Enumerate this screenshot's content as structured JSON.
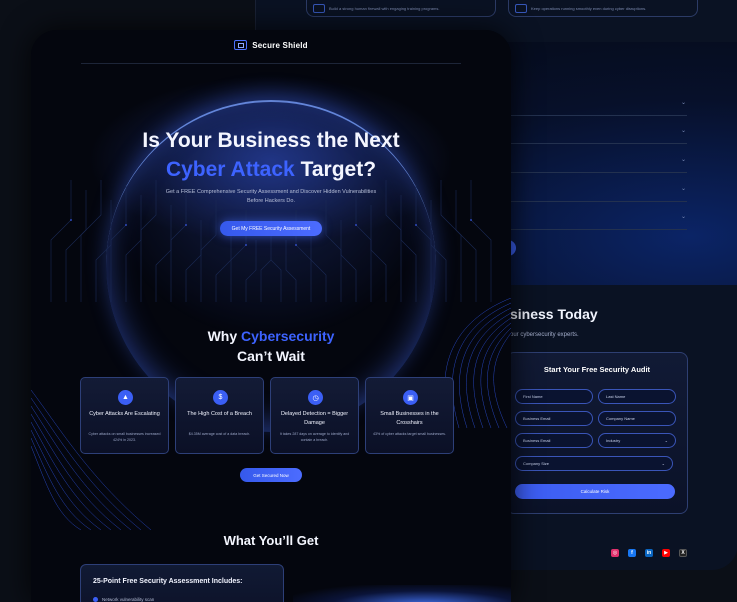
{
  "background_page": {
    "top_features": [
      {
        "text": "Build a strong human firewall with engaging training programs."
      },
      {
        "text": "Keep operations running smoothly even during cyber disruptions."
      }
    ],
    "faq_heading_fragment": "s",
    "faq_rows": 6,
    "consult": {
      "headline_fragment": "siness Today",
      "sub_fragment": "our cybersecurity experts."
    },
    "audit_form": {
      "title": "Start Your Free Security Audit",
      "first_name": "First Name",
      "last_name": "Last Name",
      "business_email": "Business Email",
      "company_name": "Company Name",
      "business_email_2": "Business Email",
      "industry": "Industry",
      "company_size": "Company Size",
      "submit": "Calculate Risk"
    },
    "socials": [
      {
        "name": "instagram-icon",
        "glyph": "◎",
        "color": "#e1306c"
      },
      {
        "name": "facebook-icon",
        "glyph": "f",
        "color": "#1877f2"
      },
      {
        "name": "linkedin-icon",
        "glyph": "in",
        "color": "#0a66c2"
      },
      {
        "name": "youtube-icon",
        "glyph": "▶",
        "color": "#ff0000"
      },
      {
        "name": "x-icon",
        "glyph": "X",
        "color": "#222222"
      }
    ]
  },
  "front_page": {
    "brand": "Secure Shield",
    "hero": {
      "title_line1": "Is Your Business the Next",
      "title_accent": "Cyber Attack",
      "title_rest": " Target?",
      "subtitle": "Get a FREE Comprehensive Security Assessment and Discover Hidden Vulnerabilities Before Hackers Do.",
      "cta": "Get My FREE Security Assessment"
    },
    "why": {
      "title_prefix": "Why ",
      "title_accent": "Cybersecurity",
      "title_line2": "Can’t Wait",
      "cards": [
        {
          "icon": "warning-icon",
          "glyph": "▲",
          "title": "Cyber Attacks Are Escalating",
          "desc": "Cyber attacks on small businesses increased 424% in 2023."
        },
        {
          "icon": "money-icon",
          "glyph": "$",
          "title": "The High Cost of a Breach",
          "desc": "$4.35M average cost of a data breach."
        },
        {
          "icon": "clock-icon",
          "glyph": "◷",
          "title": "Delayed Detection = Bigger Damage",
          "desc": "It takes 287 days on average to identify and contain a breach."
        },
        {
          "icon": "briefcase-icon",
          "glyph": "▣",
          "title": "Small Businesses in the Crosshairs",
          "desc": "43% of cyber attacks target small businesses."
        }
      ],
      "cta": "Get Secured Now"
    },
    "get": {
      "title": "What You’ll Get",
      "includes_title": "25-Point Free Security Assessment Includes:",
      "first_item": "Network vulnerability scan"
    }
  },
  "colors": {
    "accent": "#3d63ff",
    "page_bg": "#04060e"
  }
}
